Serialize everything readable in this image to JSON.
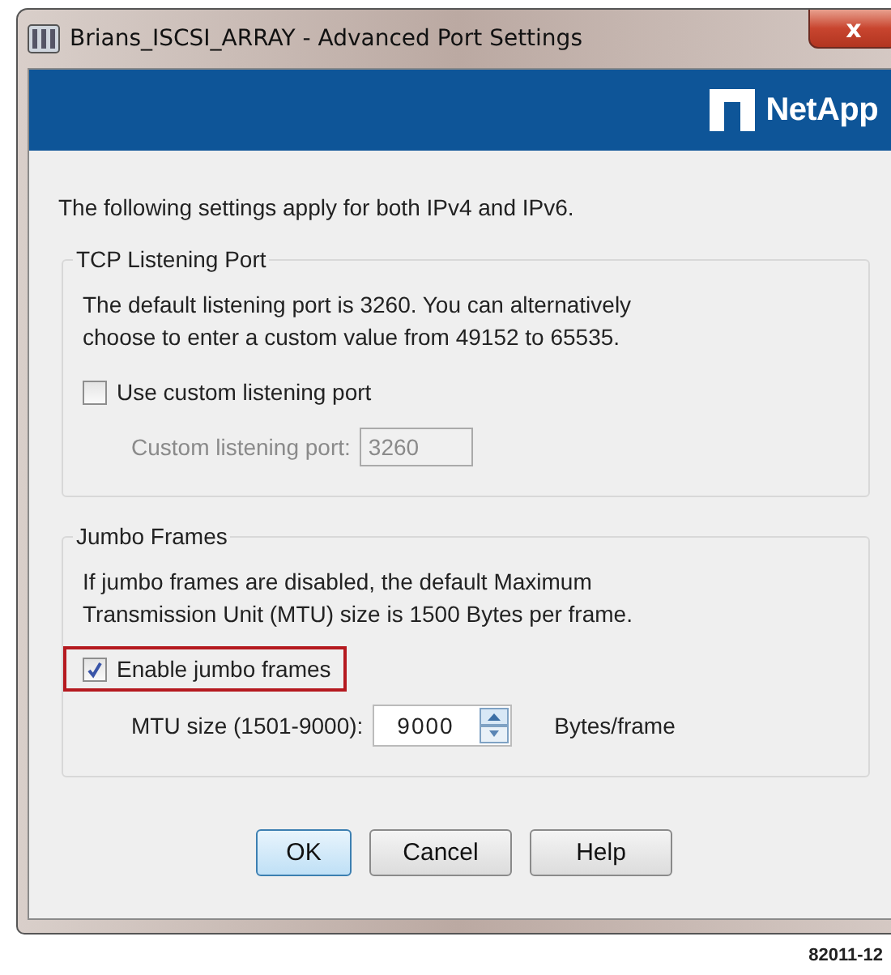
{
  "window": {
    "title": "Brians_ISCSI_ARRAY - Advanced Port Settings",
    "close_label": "x"
  },
  "banner": {
    "logo_text": "NetApp"
  },
  "intro": "The following settings apply for both IPv4 and IPv6.",
  "groups": [
    {
      "title": "TCP Listening Port",
      "description": "The default listening port is 3260. You can alternatively choose to enter a custom value from 49152 to 65535.",
      "checkbox": {
        "label": "Use custom listening port",
        "checked": false,
        "highlighted": false
      },
      "field": {
        "label": "Custom listening port:",
        "value": "3260",
        "disabled": true,
        "spinner": false
      }
    },
    {
      "title": "Jumbo Frames",
      "description": "If jumbo frames are disabled, the default Maximum Transmission Unit (MTU) size is 1500 Bytes per frame.",
      "checkbox": {
        "label": "Enable jumbo frames",
        "checked": true,
        "highlighted": true
      },
      "field": {
        "label": "MTU size (1501-9000):",
        "value": "9000",
        "disabled": false,
        "spinner": true,
        "unit": "Bytes/frame"
      }
    }
  ],
  "buttons": [
    {
      "label": "OK",
      "default": true
    },
    {
      "label": "Cancel",
      "default": false
    },
    {
      "label": "Help",
      "default": false
    }
  ],
  "figure_number": "82011-12"
}
